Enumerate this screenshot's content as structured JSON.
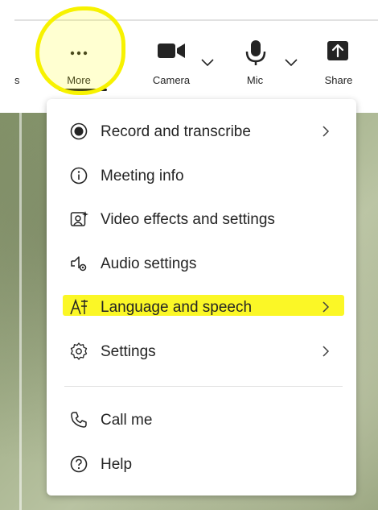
{
  "toolbar": {
    "partial_label": "s",
    "more": {
      "label": "More",
      "icon": "ellipsis-icon"
    },
    "camera": {
      "label": "Camera",
      "icon": "video-camera-icon"
    },
    "mic": {
      "label": "Mic",
      "icon": "microphone-icon"
    },
    "share": {
      "label": "Share",
      "icon": "share-tray-icon"
    }
  },
  "menu": {
    "items": [
      {
        "label": "Record and transcribe",
        "icon": "record-icon",
        "has_submenu": true
      },
      {
        "label": "Meeting info",
        "icon": "info-icon",
        "has_submenu": false
      },
      {
        "label": "Video effects and settings",
        "icon": "video-effects-icon",
        "has_submenu": false
      },
      {
        "label": "Audio settings",
        "icon": "speaker-settings-icon",
        "has_submenu": false
      },
      {
        "label": "Language and speech",
        "icon": "language-icon",
        "has_submenu": true
      },
      {
        "label": "Settings",
        "icon": "gear-icon",
        "has_submenu": true
      },
      {
        "label": "Call me",
        "icon": "phone-icon",
        "has_submenu": false
      },
      {
        "label": "Help",
        "icon": "help-icon",
        "has_submenu": false
      }
    ]
  },
  "colors": {
    "highlight": "#f7f200",
    "text": "#242424",
    "menu_bg": "#ffffff"
  }
}
